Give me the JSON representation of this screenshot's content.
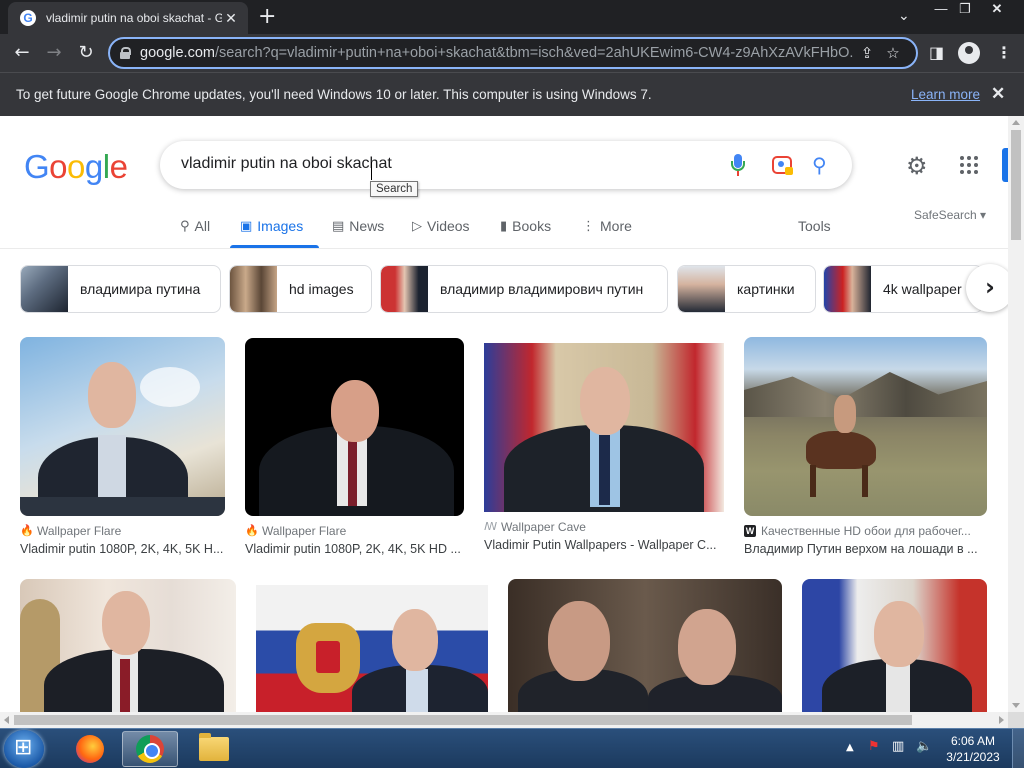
{
  "browser": {
    "tab_title": "vladimir putin na oboi skachat - G",
    "tab_close": "✕",
    "new_tab": "+",
    "url_host": "google.com",
    "url_path": "/search?q=vladimir+putin+na+oboi+skachat&tbm=isch&ved=2ahUKEwim6-CW4-z9AhXzAVkFHbO...",
    "infobar_message": "To get future Google Chrome updates, you'll need Windows 10 or later. This computer is using Windows 7.",
    "infobar_link": "Learn more"
  },
  "google": {
    "logo": [
      "G",
      "o",
      "o",
      "g",
      "l",
      "e"
    ],
    "logo_colors": [
      "#4285f4",
      "#ea4335",
      "#fbbc05",
      "#4285f4",
      "#34a853",
      "#ea4335"
    ],
    "query": "vladimir putin na oboi skachat",
    "tooltip": "Search",
    "tabs": [
      {
        "label": "All",
        "icon": "search-icon"
      },
      {
        "label": "Images",
        "icon": "image-icon"
      },
      {
        "label": "News",
        "icon": "news-icon"
      },
      {
        "label": "Videos",
        "icon": "play-icon"
      },
      {
        "label": "Books",
        "icon": "book-icon"
      },
      {
        "label": "More",
        "icon": "more-icon"
      }
    ],
    "tools": "Tools",
    "safesearch": "SafeSearch ▾"
  },
  "chips": [
    {
      "label": "владимира путина"
    },
    {
      "label": "hd images"
    },
    {
      "label": "владимир владимирович путин"
    },
    {
      "label": "картинки"
    },
    {
      "label": "4k wallpaper"
    }
  ],
  "results": [
    {
      "source": "Wallpaper Flare",
      "title": "Vladimir putin 1080P, 2K, 4K, 5K H..."
    },
    {
      "source": "Wallpaper Flare",
      "title": "Vladimir putin 1080P, 2K, 4K, 5K HD ..."
    },
    {
      "source": "Wallpaper Cave",
      "title": "Vladimir Putin Wallpapers - Wallpaper C..."
    },
    {
      "source": "Качественные HD обои для рабочег...",
      "title": "Владимир Путин верхом на лошади в ..."
    }
  ],
  "taskbar": {
    "time": "6:06 AM",
    "date": "3/21/2023"
  },
  "colors": {
    "accent": "#1a73e8",
    "chrome_dark": "#35363a"
  }
}
